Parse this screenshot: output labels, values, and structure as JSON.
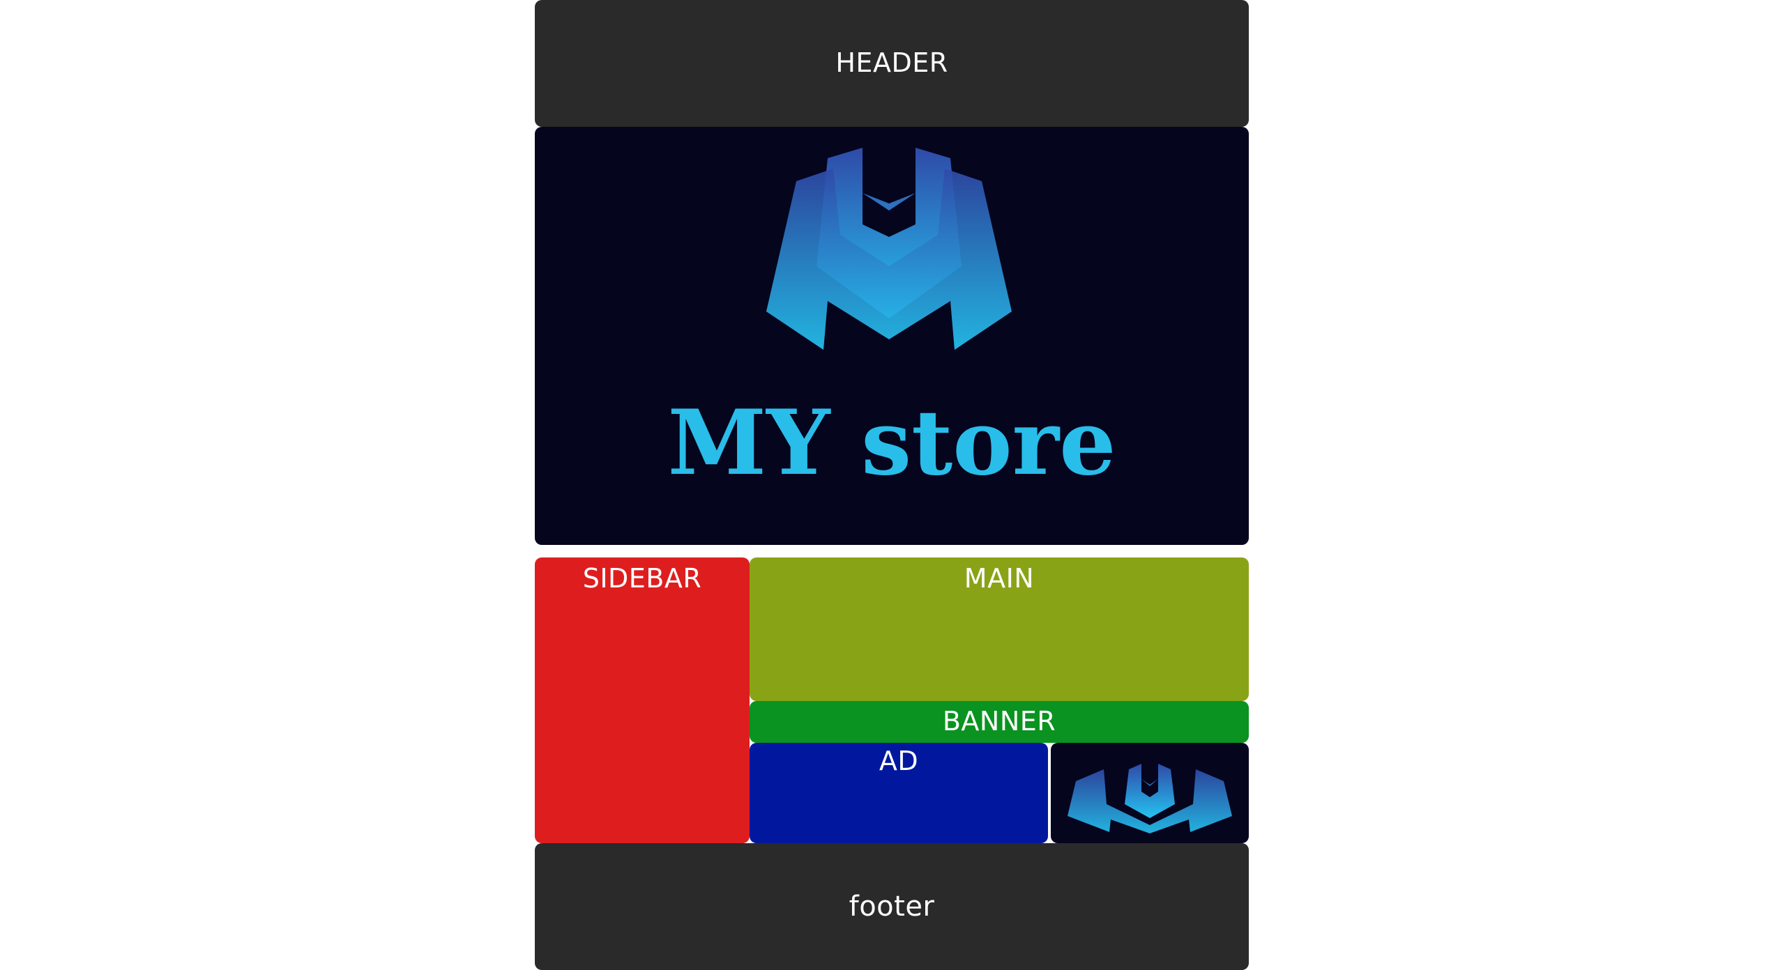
{
  "layout_demo": {
    "header_label": "HEADER",
    "logo": {
      "brand_text": "MY store",
      "colors": {
        "gradient_top": "#2f4aa8",
        "gradient_bottom": "#25c3f0",
        "text": "#29bdea",
        "background": "#06051e"
      }
    },
    "sidebar_label": "SIDEBAR",
    "main_label": "MAIN",
    "banner_label": "BANNER",
    "ad_label": "AD",
    "footer_label": "footer"
  },
  "colors": {
    "header_bg": "#2a2a2a",
    "sidebar_bg": "#de1e1e",
    "main_bg": "#88a416",
    "banner_bg": "#0a9320",
    "ad_bg": "#01189e",
    "footer_bg": "#2a2a2a",
    "page_bg": "#ffffff"
  }
}
